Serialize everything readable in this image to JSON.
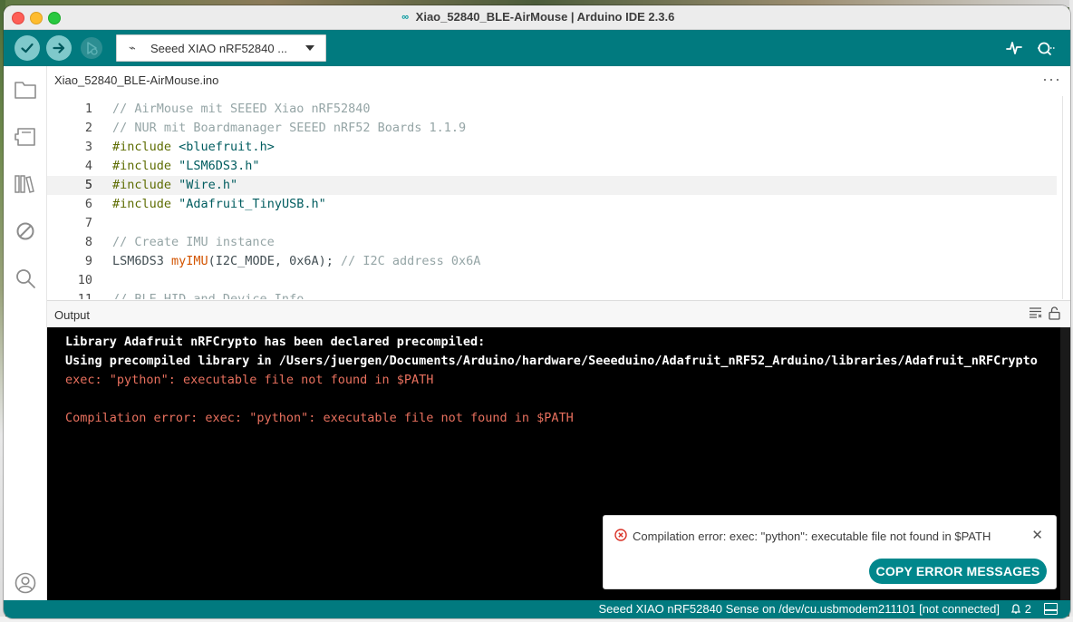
{
  "window": {
    "title": "Xiao_52840_BLE-AirMouse | Arduino IDE 2.3.6"
  },
  "toolbar": {
    "board_selector": "Seeed XIAO nRF52840 ...",
    "icons": [
      "verify-icon",
      "upload-icon",
      "debug-icon",
      "serial-plotter-icon",
      "serial-monitor-icon"
    ]
  },
  "sidebar": {
    "icons": [
      "sketchbook-icon",
      "boards-manager-icon",
      "library-manager-icon",
      "debug-disabled-icon",
      "search-icon",
      "account-icon"
    ]
  },
  "editor": {
    "tab_label": "Xiao_52840_BLE-AirMouse.ino",
    "current_line": 5,
    "lines": [
      {
        "n": "1",
        "text": "// AirMouse mit SEEED Xiao nRF52840"
      },
      {
        "n": "2",
        "text": "// NUR mit Boardmanager SEEED nRF52 Boards 1.1.9"
      },
      {
        "n": "3",
        "kw": "#include",
        "arg": " <bluefruit.h>"
      },
      {
        "n": "4",
        "kw": "#include",
        "arg": " \"LSM6DS3.h\""
      },
      {
        "n": "5",
        "kw": "#include",
        "arg": " \"Wire.h\""
      },
      {
        "n": "6",
        "kw": "#include",
        "arg": " \"Adafruit_TinyUSB.h\""
      },
      {
        "n": "7",
        "text": ""
      },
      {
        "n": "8",
        "text": "// Create IMU instance"
      },
      {
        "n": "9",
        "type": "LSM6DS3 ",
        "fn": "myIMU",
        "args": "(I2C_MODE, 0x6A); ",
        "comment": "// I2C address 0x6A"
      },
      {
        "n": "10",
        "text": ""
      },
      {
        "n": "11",
        "text": "// BLE HID and Device Info"
      }
    ]
  },
  "output": {
    "header": "Output",
    "lines": [
      "Library Adafruit nRFCrypto has been declared precompiled:",
      "Using precompiled library in /Users/juergen/Documents/Arduino/hardware/Seeeduino/Adafruit_nRF52_Arduino/libraries/Adafruit_nRFCrypto",
      "exec: \"python\": executable file not found in $PATH",
      "",
      "Compilation error: exec: \"python\": executable file not found in $PATH"
    ]
  },
  "notification": {
    "message": "Compilation error: exec: \"python\": executable file not found in $PATH",
    "button_label": "COPY ERROR MESSAGES"
  },
  "statusbar": {
    "board_status": "Seeed XIAO nRF52840 Sense on /dev/cu.usbmodem211101 [not connected]",
    "notification_count": "2"
  },
  "colors": {
    "toolbar": "#017a7f",
    "accent": "#01878c",
    "error_text": "#e8705e",
    "output_bg": "#000000"
  }
}
